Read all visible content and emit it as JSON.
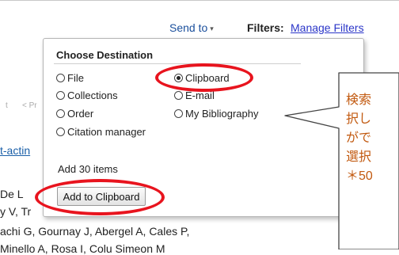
{
  "toolbar": {
    "send_to_label": "Send to",
    "send_to_caret": "▾",
    "filters_label": "Filters:",
    "manage_filters_link": "Manage Filters"
  },
  "background": {
    "pager_first": "t",
    "pager_prev": "< Pr",
    "result_link": "t-actin",
    "author_lines": [
      "De L",
      "y V, Tr",
      "achi G, Gournay J, Abergel A, Cales P,",
      "Minello A, Rosa I, Colu Simeon M"
    ]
  },
  "popup": {
    "title": "Choose Destination",
    "options": [
      {
        "label": "File",
        "selected": false
      },
      {
        "label": "Clipboard",
        "selected": true
      },
      {
        "label": "Collections",
        "selected": false
      },
      {
        "label": "E-mail",
        "selected": false
      },
      {
        "label": "Order",
        "selected": false
      },
      {
        "label": "My Bibliography",
        "selected": false
      },
      {
        "label": "Citation manager",
        "selected": false
      }
    ],
    "add_items_text": "Add 30 items",
    "add_button_label": "Add to Clipboard"
  },
  "callout": {
    "lines": [
      "検索",
      "択し",
      "がで",
      "選択",
      "＊50"
    ]
  },
  "colors": {
    "highlight_red": "#e8141e",
    "callout_text": "#c25a10",
    "link_blue": "#2b36c8"
  }
}
